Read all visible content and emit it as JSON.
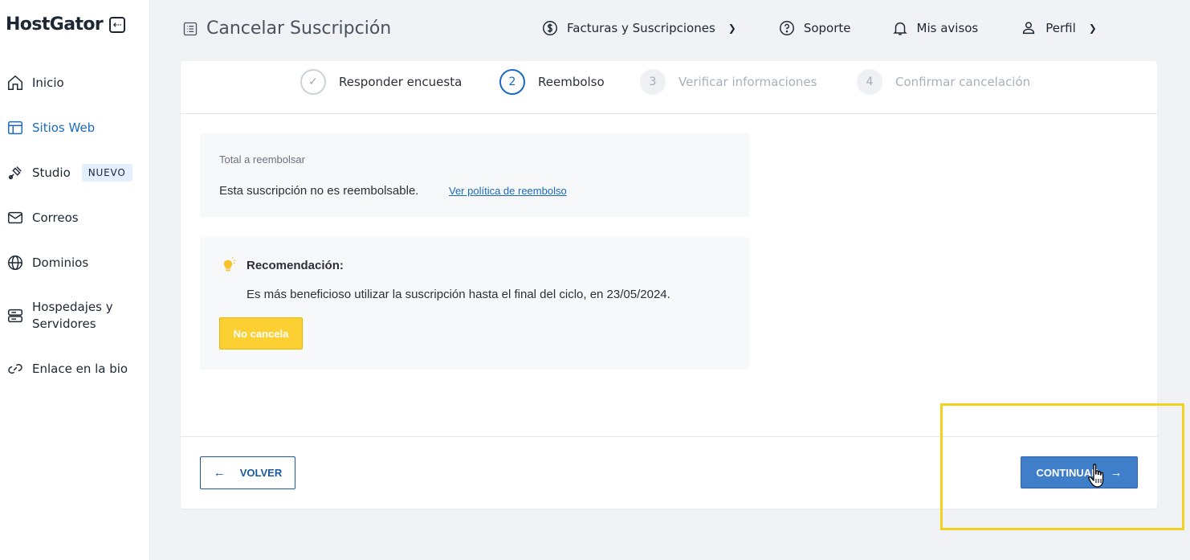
{
  "brand": {
    "name": "HostGator",
    "collapse_icon": "arrow-left-box-icon"
  },
  "sidebar": {
    "items": [
      {
        "label": "Inicio",
        "icon": "home-icon"
      },
      {
        "label": "Sitios Web",
        "icon": "layout-icon",
        "active": true
      },
      {
        "label": "Studio",
        "icon": "brush-icon",
        "badge": "NUEVO"
      },
      {
        "label": "Correos",
        "icon": "mail-icon"
      },
      {
        "label": "Dominios",
        "icon": "globe-icon"
      },
      {
        "label": "Hospedajes y",
        "label2": "Servidores",
        "icon": "server-icon"
      },
      {
        "label": "Enlace en la bio",
        "icon": "link-icon"
      }
    ]
  },
  "header": {
    "title": "Cancelar Suscripción",
    "title_icon": "list-icon",
    "links": [
      {
        "label": "Facturas y Suscripciones",
        "icon": "dollar-circle-icon",
        "dropdown": true
      },
      {
        "label": "Soporte",
        "icon": "question-circle-icon"
      },
      {
        "label": "Mis avisos",
        "icon": "bell-icon"
      },
      {
        "label": "Perfil",
        "icon": "user-icon",
        "dropdown": true
      }
    ]
  },
  "steps": [
    {
      "label": "Responder encuesta",
      "state": "done",
      "marker": "✓"
    },
    {
      "label": "Reembolso",
      "state": "current",
      "marker": "2"
    },
    {
      "label": "Verificar informaciones",
      "state": "pending",
      "marker": "3"
    },
    {
      "label": "Confirmar cancelación",
      "state": "pending",
      "marker": "4"
    }
  ],
  "refund": {
    "label": "Total a reembolsar",
    "text": "Esta suscripción no es reembolsable.",
    "link": "Ver política de reembolso"
  },
  "recommendation": {
    "title": "Recomendación:",
    "text": "Es más beneficioso utilizar la suscripción hasta el final del ciclo, en 23/05/2024.",
    "button": "No cancela",
    "icon": "lightbulb-icon"
  },
  "actions": {
    "back": "VOLVER",
    "next": "CONTINUAR"
  },
  "colors": {
    "accent": "#1a6ac2",
    "primary_button": "#3f7ec9",
    "warning_button": "#fccf33",
    "highlight": "#f2d21f"
  }
}
